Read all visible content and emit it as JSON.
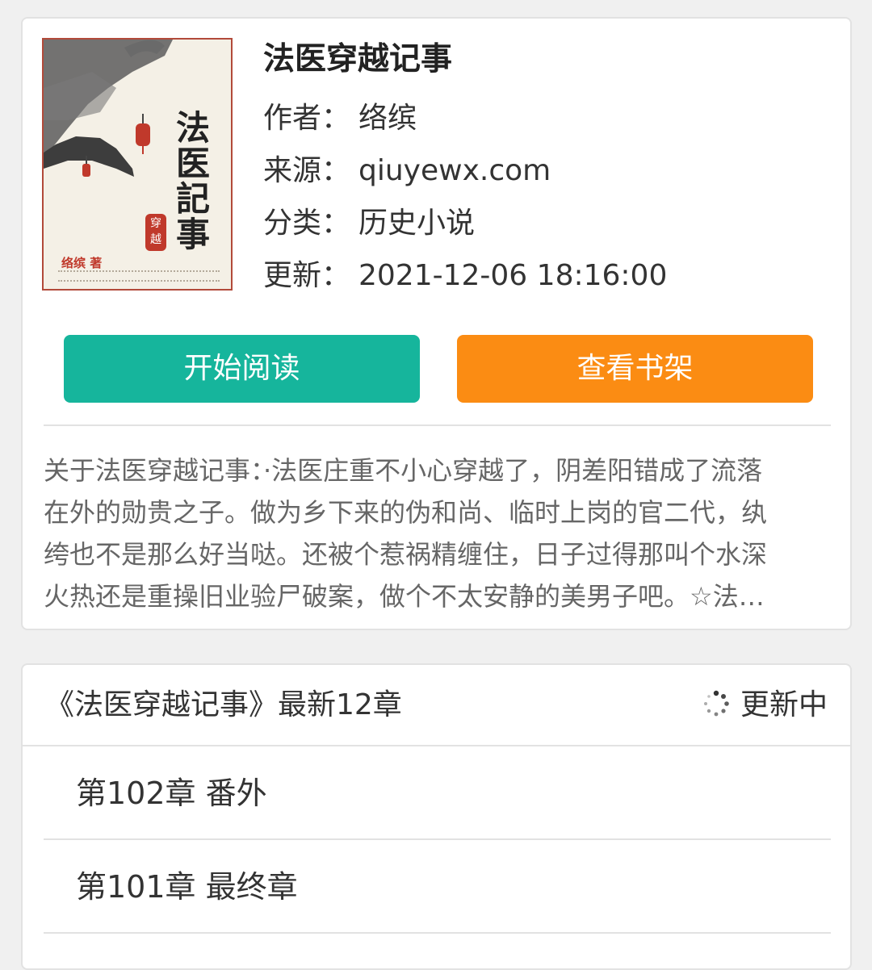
{
  "book": {
    "title": "法医穿越记事",
    "cover": {
      "title_chars": [
        "法",
        "医",
        "記",
        "事"
      ],
      "seal_text": "穿越",
      "author_text": "络缤 著"
    },
    "meta": [
      {
        "label": "作者：",
        "value": "络缤"
      },
      {
        "label": "来源：",
        "value": "qiuyewx.com"
      },
      {
        "label": "分类：",
        "value": "历史小说"
      },
      {
        "label": "更新：",
        "value": "2021-12-06 18:16:00"
      }
    ],
    "buttons": {
      "read_label": "开始阅读",
      "shelf_label": "查看书架"
    },
    "intro_lines": [
      "关于法医穿越记事：·法医庄重不小心穿越了，阴差阳错成了流落",
      "在外的勋贵之子。做为乡下来的伪和尚、临时上岗的官二代，纨",
      "绔也不是那么好当哒。还被个惹祸精缠住，日子过得那叫个水深",
      "火热还是重操旧业验尸破案，做个不太安静的美男子吧。☆法…"
    ]
  },
  "chapters": {
    "header_title": "《法医穿越记事》最新12章",
    "status_label": "更新中",
    "status_icon": "loading-spinner-icon",
    "items": [
      {
        "label": "第102章 番外"
      },
      {
        "label": "第101章 最终章"
      }
    ]
  },
  "colors": {
    "read_button": "#16b59c",
    "shelf_button": "#fb8c13",
    "page_background": "#f0f0f0",
    "card_background": "#ffffff"
  }
}
